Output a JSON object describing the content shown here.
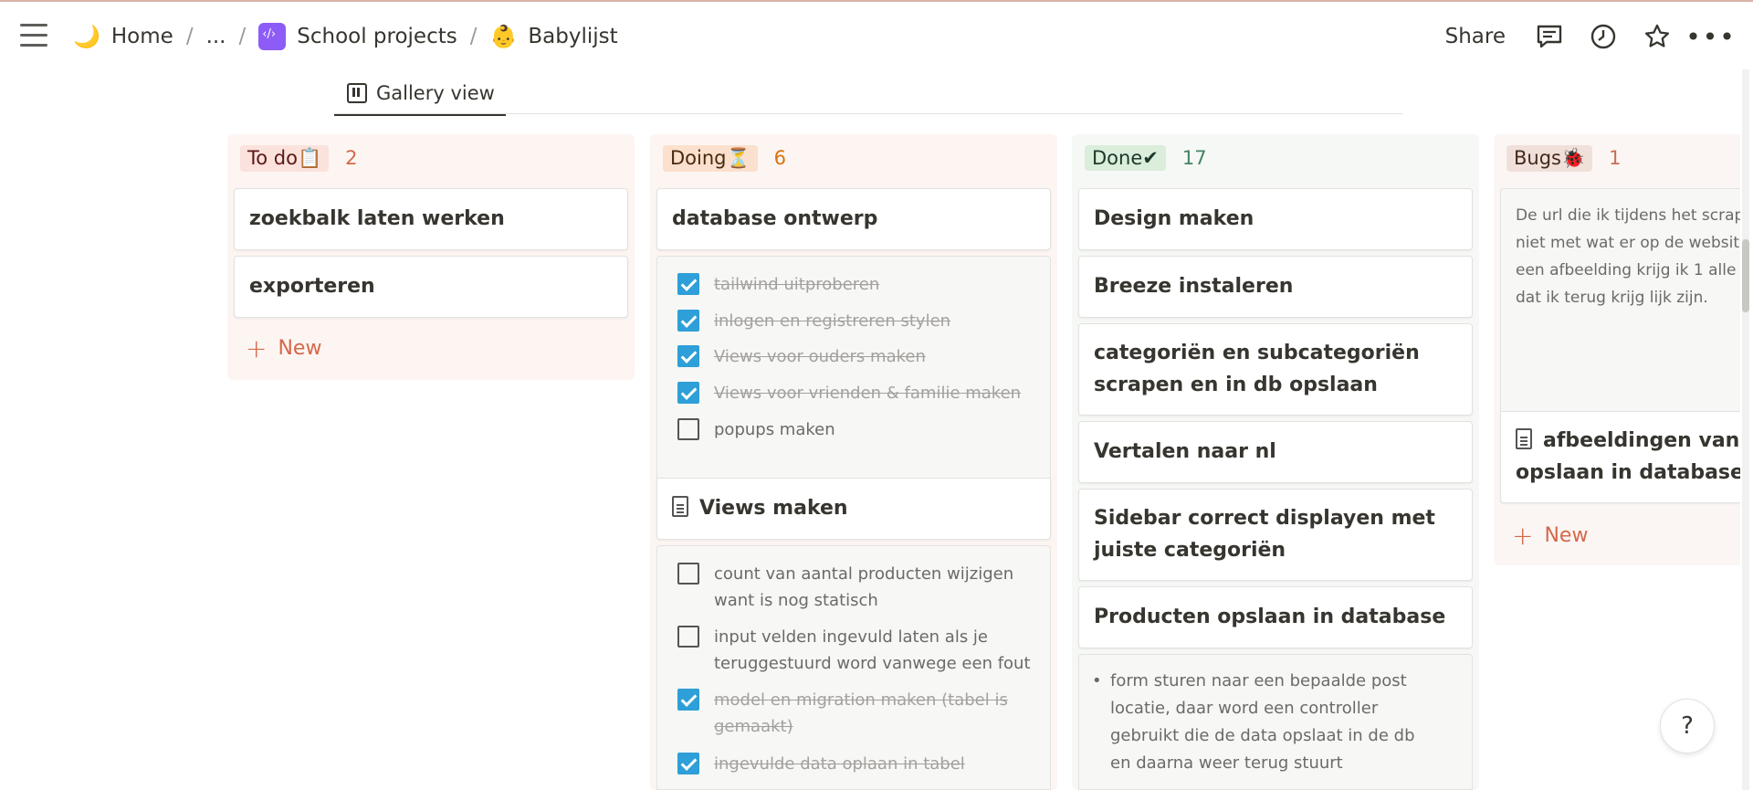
{
  "breadcrumb": {
    "home_icon": "🌙",
    "home": "Home",
    "ellipsis": "...",
    "sep": "/",
    "school_projects": "School projects",
    "page_icon": "👶",
    "page": "Babylijst"
  },
  "actions": {
    "share": "Share",
    "comment_icon": "comment-icon",
    "clock_icon": "clock-icon",
    "star_icon": "star-icon",
    "more": "•••"
  },
  "view": {
    "tab_label": "Gallery view"
  },
  "new_label": "New",
  "columns": {
    "todo": {
      "label": "To do📋",
      "count": "2",
      "cards": [
        "zoekbalk laten werken",
        "exporteren"
      ]
    },
    "doing": {
      "label": "Doing⏳",
      "count": "6",
      "card1": "database ontwerp",
      "checklist1": [
        {
          "text": "tailwind uitproberen",
          "done": true
        },
        {
          "text": "inlogen en registreren stylen",
          "done": true
        },
        {
          "text": "Views voor ouders maken",
          "done": true
        },
        {
          "text": "Views voor vrienden & familie maken",
          "done": true
        },
        {
          "text": "popups maken",
          "done": false
        }
      ],
      "card2": "Views maken",
      "checklist2": [
        {
          "text": "count van aantal producten wijzigen want is nog statisch",
          "done": false
        },
        {
          "text": "input velden ingevuld laten als je teruggestuurd word vanwege een fout",
          "done": false
        },
        {
          "text": "model en migration maken (tabel is gemaakt)",
          "done": true
        },
        {
          "text": "ingevulde data oplaan in tabel",
          "done": true
        }
      ]
    },
    "done": {
      "label": "Done✔",
      "count": "17",
      "cards": [
        "Design maken",
        "Breeze instaleren",
        "categoriën en subcategoriën scrapen en in db opslaan",
        "Vertalen naar nl",
        "Sidebar correct displayen met juiste categoriën",
        "Producten opslaan in database"
      ],
      "bullet": "form sturen naar een bepaalde post locatie, daar word een controller gebruikt die de data opslaat in de db en daarna weer terug stuurt"
    },
    "bugs": {
      "label": "Bugs🐞",
      "count": "1",
      "preview_text": "De url die ik tijdens het scrapen niet met wat er op de website van een afbeelding krijg ik 1 alle urls dat ik terug krijg lijk zijn.",
      "card": "afbeeldingen van pr opslaan in database"
    }
  },
  "colors": {
    "todo_bg": "#fdf5f2",
    "todo_pill": "#fbe2dd",
    "todo_count": "#d4694b",
    "doing_bg": "#fcf5f2",
    "doing_pill": "#fbe0cd",
    "doing_count": "#d9730d",
    "done_bg": "#f6f8f6",
    "done_pill": "#dbeddb",
    "done_count": "#448361",
    "bugs_bg": "#fbf6f4",
    "bugs_pill": "#f1e0da",
    "bugs_count": "#c66e55",
    "check_blue": "#2e9fd8"
  },
  "help": "?"
}
